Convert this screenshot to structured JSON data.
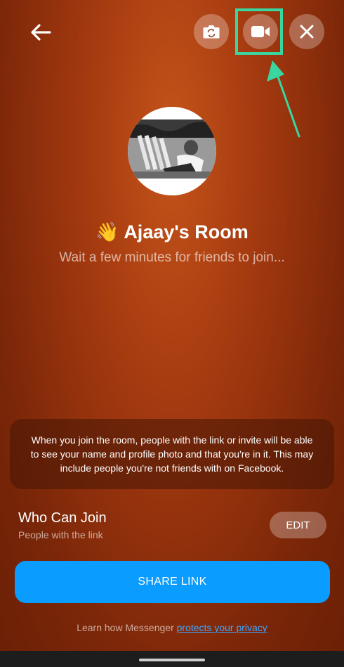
{
  "header": {
    "back_icon": "arrow-left-icon",
    "flip_camera_icon": "camera-flip-icon",
    "video_icon": "video-camera-icon",
    "close_icon": "close-icon",
    "highlight_color": "#3ad6a0"
  },
  "room": {
    "emoji": "👋",
    "title": "Ajaay's Room",
    "subtitle": "Wait a few minutes for friends to join..."
  },
  "notice": {
    "text": "When you join the room, people with the link or invite will be able to see your name and profile photo and that you're in it. This may include people you're not friends with on Facebook."
  },
  "who_can_join": {
    "title": "Who Can Join",
    "value": "People with the link",
    "edit_label": "EDIT"
  },
  "share": {
    "label": "SHARE LINK",
    "color": "#0a9cff"
  },
  "footer": {
    "prefix": "Learn how Messenger ",
    "link_text": "protects your privacy"
  }
}
